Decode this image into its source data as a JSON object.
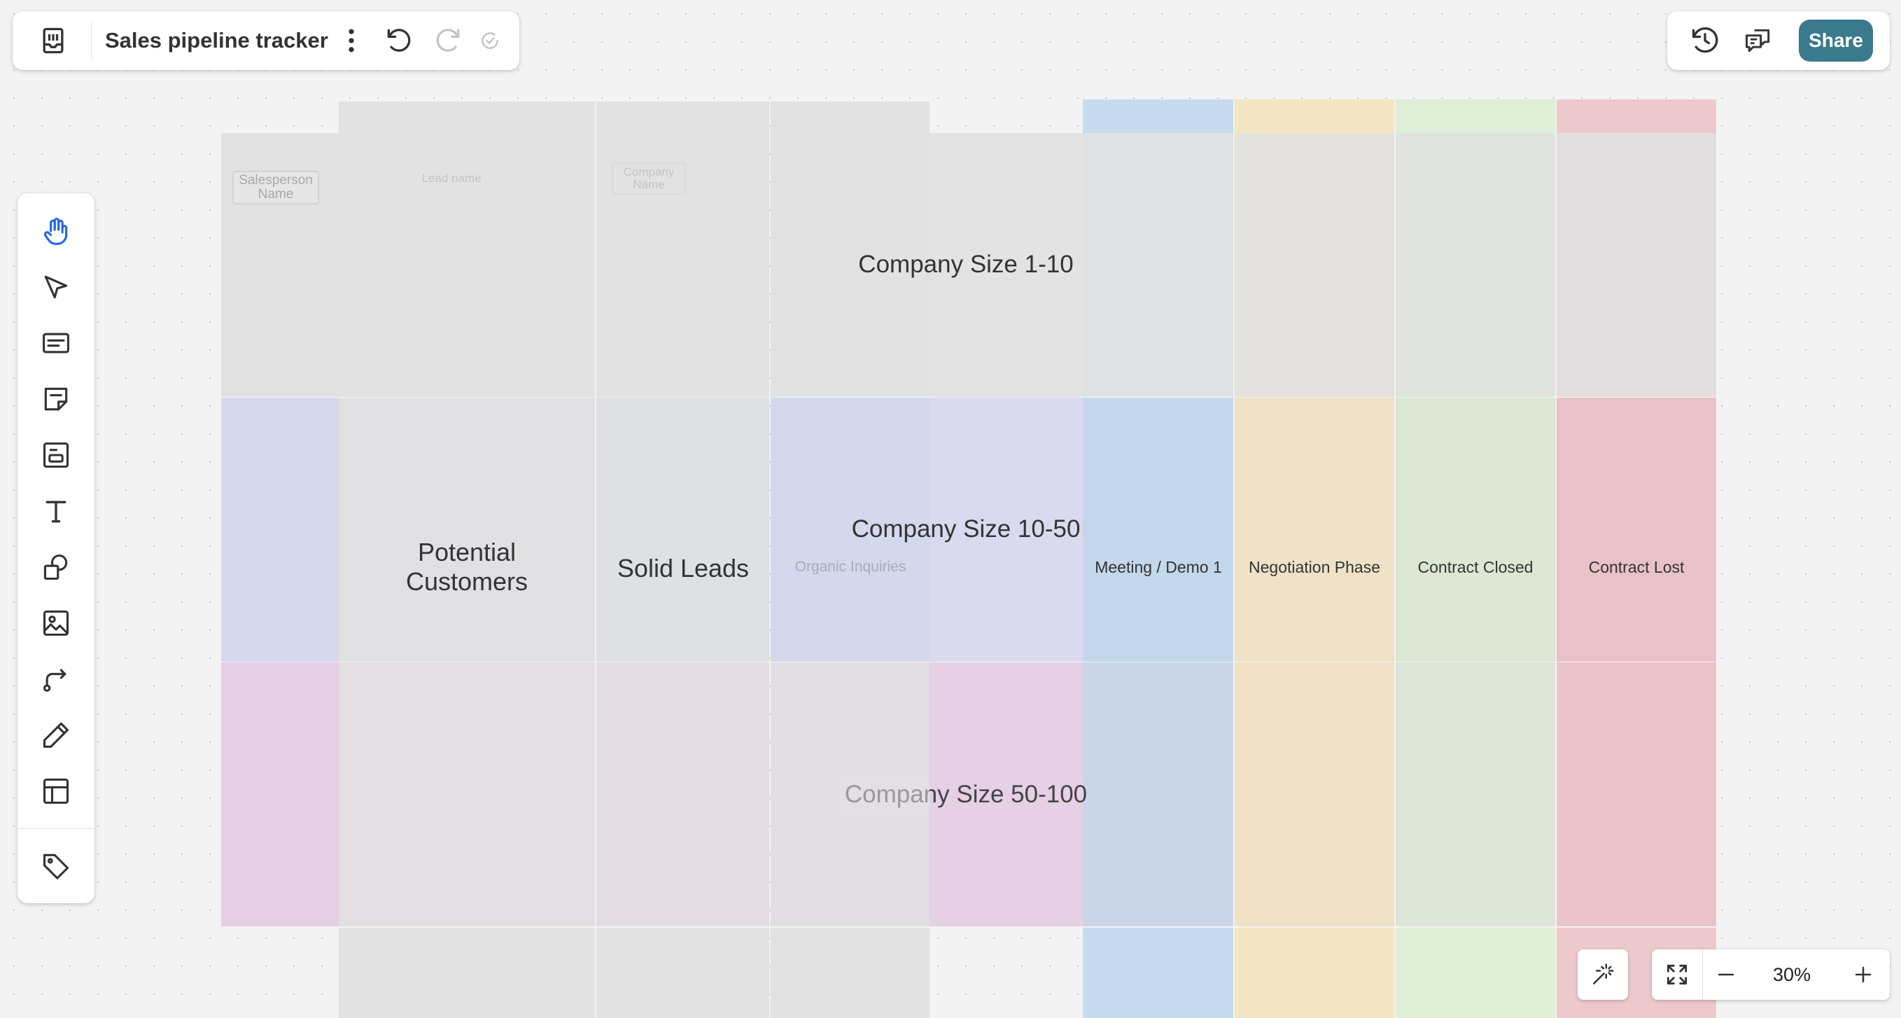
{
  "app": {
    "board_title": "Sales pipeline tracker",
    "share_label": "Share",
    "zoom_label": "30%"
  },
  "icons": {
    "topbar_left": [
      "boards-icon",
      "more-vertical-icon",
      "undo-icon",
      "redo-icon",
      "saved-check-icon"
    ],
    "topbar_right": [
      "history-icon",
      "comments-icon"
    ],
    "toolbar": [
      "hand-tool-icon",
      "select-pointer-icon",
      "text-block-icon",
      "sticky-note-icon",
      "card-icon",
      "text-tool-icon",
      "shapes-icon",
      "image-icon",
      "connector-icon",
      "pen-icon",
      "template-icon",
      "tag-icon"
    ],
    "bottom": [
      "magic-wand-icon",
      "fit-to-screen-icon",
      "zoom-out-icon",
      "zoom-in-icon"
    ]
  },
  "board": {
    "row_titles": [
      "Company Size 1-10",
      "Company Size 10-50",
      "Company Size 50-100"
    ],
    "placeholder_salesperson": "Salesperson Name",
    "placeholder_lead": "Lead name",
    "placeholder_company": "Company Name",
    "stage_potential": "Potential Customers",
    "stage_solid": "Solid Leads",
    "stage_organic": "Organic Inquiries",
    "stage_meeting": "Meeting / Demo 1",
    "stage_negotiation": "Negotiation Phase",
    "stage_closed": "Contract Closed",
    "stage_lost": "Contract Lost"
  },
  "colors": {
    "accent": "#3a7a8c",
    "active_tool": "#2563eb",
    "row1": "#e2e2e4",
    "row2": "#d7daec",
    "row3": "#e6cfe4",
    "col_meeting": "#c3d8ea",
    "col_negotiation": "#efe2c6",
    "col_closed": "#dce7d4",
    "col_lost": "#e8c2c8"
  }
}
